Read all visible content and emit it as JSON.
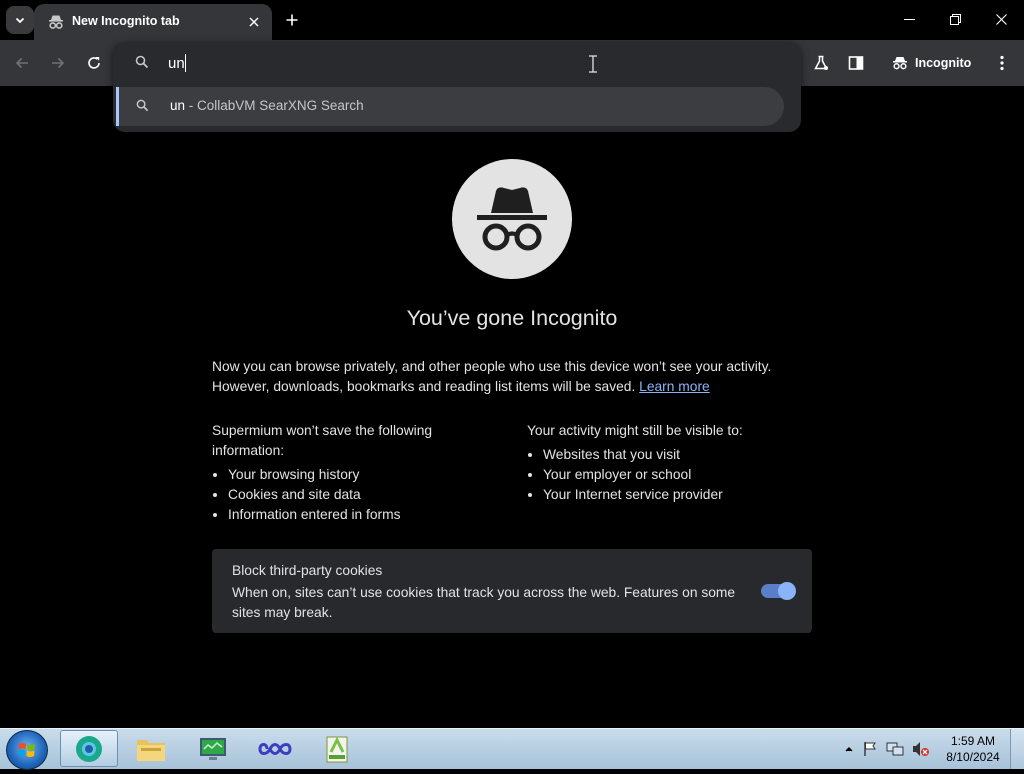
{
  "window": {
    "tab_title": "New Incognito tab"
  },
  "toolbar": {
    "profile_label": "Incognito"
  },
  "omnibox": {
    "value": "un",
    "suggestion": {
      "query": "un",
      "separator": " - ",
      "engine": "CollabVM SearXNG Search"
    }
  },
  "ntp": {
    "heading": "You’ve gone Incognito",
    "intro_line1": "Now you can browse privately, and other people who use this device won’t see your activity.",
    "intro_line2": "However, downloads, bookmarks and reading list items will be saved.",
    "learn_more": "Learn more",
    "left_column": {
      "title": "Supermium won’t save the following information:",
      "items": [
        "Your browsing history",
        "Cookies and site data",
        "Information entered in forms"
      ]
    },
    "right_column": {
      "title": "Your activity might still be visible to:",
      "items": [
        "Websites that you visit",
        "Your employer or school",
        "Your Internet service provider"
      ]
    },
    "cookie_card": {
      "title": "Block third-party cookies",
      "description": "When on, sites can’t use cookies that track you across the web. Features on some sites may break.",
      "toggle_on": true
    }
  },
  "taskbar": {
    "time": "1:59 AM",
    "date": "8/10/2024"
  },
  "colors": {
    "toolbar_bg": "#35363a",
    "page_bg": "#000000",
    "link": "#8ab4f8",
    "toggle_accent": "#8ab4f8"
  }
}
